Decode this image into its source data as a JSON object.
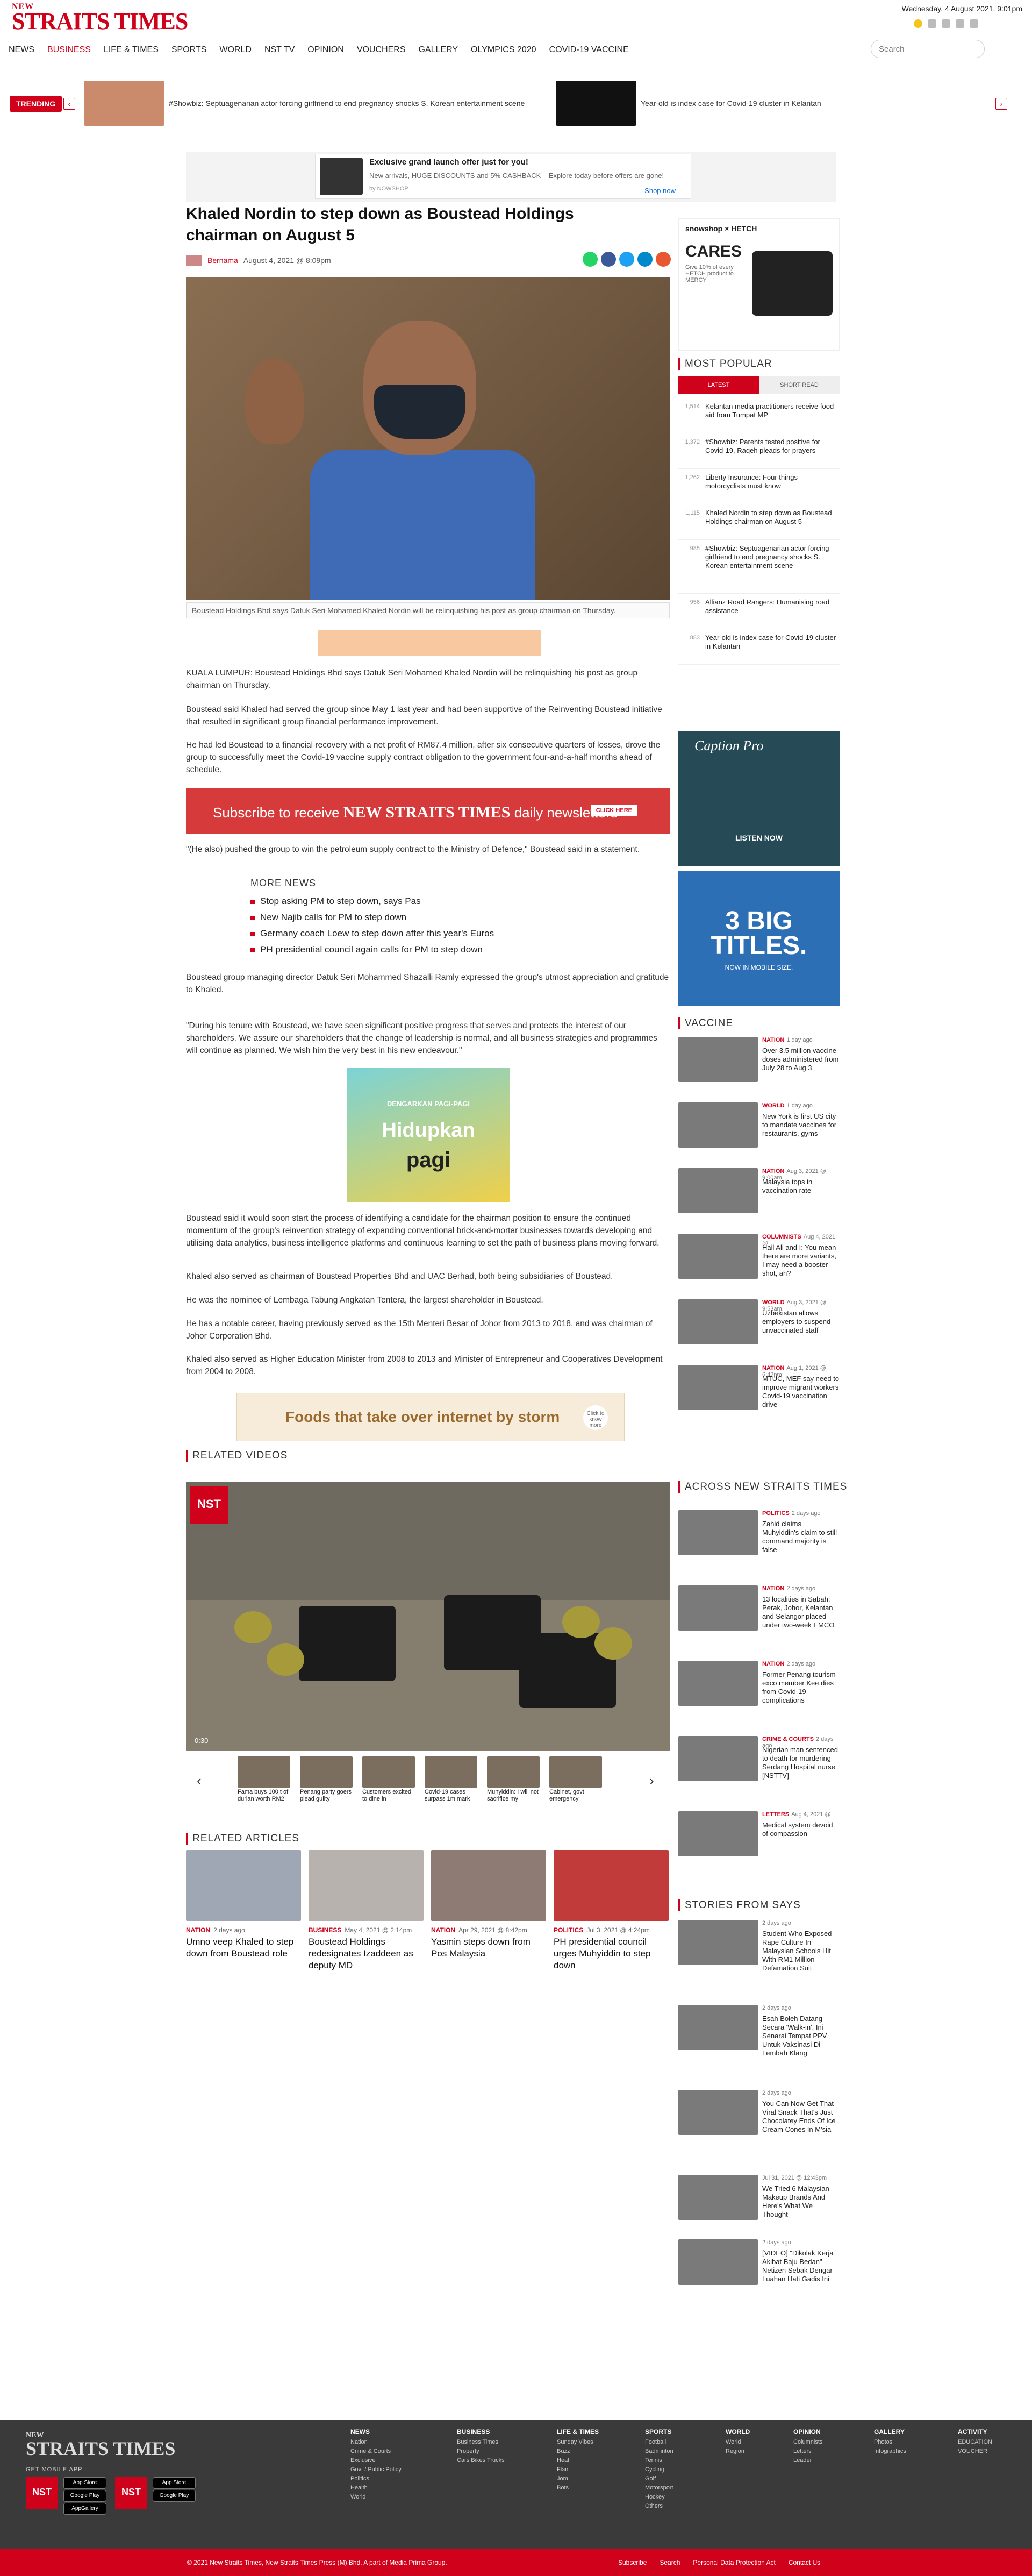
{
  "header": {
    "logo_new": "NEW",
    "logo_main": "STRAITS TIMES",
    "date": "Wednesday, 4 August 2021, 9:01pm"
  },
  "nav": [
    "NEWS",
    "BUSINESS",
    "LIFE & TIMES",
    "SPORTS",
    "WORLD",
    "NST TV",
    "OPINION",
    "VOUCHERS",
    "GALLERY",
    "OLYMPICS 2020",
    "COVID-19 VACCINE"
  ],
  "search": {
    "placeholder": "Search"
  },
  "trending": {
    "label": "TRENDING",
    "items": [
      "#Showbiz: Septuagenarian actor forcing girlfriend to end pregnancy shocks S. Korean entertainment scene",
      "Year-old is index case for Covid-19 cluster in Kelantan"
    ]
  },
  "ad_top": {
    "title": "Exclusive grand launch offer just for you!",
    "sub": "New arrivals, HUGE DISCOUNTS and 5% CASHBACK – Explore today before offers are gone!",
    "source": "by NOWSHOP",
    "cta": "Shop now"
  },
  "article": {
    "headline": "Khaled Nordin to step down as Boustead Holdings chairman on August 5",
    "author": "Bernama",
    "date": "August 4, 2021 @ 8:09pm",
    "caption": "Boustead Holdings Bhd says Datuk Seri Mohamed Khaled Nordin will be relinquishing his post as group chairman on Thursday.",
    "paragraphs": [
      "KUALA LUMPUR: Boustead Holdings Bhd says Datuk Seri Mohamed Khaled Nordin will be relinquishing his post as group chairman on Thursday.",
      "Boustead said Khaled had served the group since May 1 last year and had been supportive of the Reinventing Boustead initiative that resulted in significant group financial performance improvement.",
      "He had led Boustead to a financial recovery with a net profit of RM87.4 million, after six consecutive quarters of losses, drove the group to successfully meet the Covid-19 vaccine supply contract obligation to the government four-and-a-half months ahead of schedule.",
      "\"(He also) pushed the group to win the petroleum supply contract to the Ministry of Defence,\" Boustead said in a statement.",
      "Boustead group managing director Datuk Seri Mohammed Shazalli Ramly expressed the group's utmost appreciation and gratitude to Khaled.",
      "\"During his tenure with Boustead, we have seen significant positive progress that serves and protects the interest of our shareholders. We assure our shareholders that the change of leadership is normal, and all business strategies and programmes will continue as planned. We wish him the very best in his new endeavour.\"",
      "Boustead said it would soon start the process of identifying a candidate for the chairman position to ensure the continued momentum of the group's reinvention strategy of expanding conventional brick-and-mortar businesses towards developing and utilising data analytics, business intelligence platforms and continuous learning to set the path of business plans moving forward.",
      "Khaled also served as chairman of Boustead Properties Bhd and UAC Berhad, both being subsidiaries of Boustead.",
      "He was the nominee of Lembaga Tabung Angkatan Tentera, the largest shareholder in Boustead.",
      "He has a notable career, having previously served as the 15th Menteri Besar of Johor from 2013 to 2018, and was chairman of Johor Corporation Bhd.",
      "Khaled also served as Higher Education Minister from 2008 to 2013 and Minister of Entrepreneur and Cooperatives Development from 2004 to 2008."
    ]
  },
  "subscribe": {
    "text": "Subscribe to receive",
    "brand": "NEW STRAITS TIMES",
    "tail": "daily newsletters",
    "cta": "CLICK HERE"
  },
  "more_news": {
    "title": "MORE NEWS",
    "items": [
      "Stop asking PM to step down, says Pas",
      "New Najib calls for PM to step down",
      "Germany coach Loew to step down after this year's Euros",
      "PH presidential council again calls for PM to step down"
    ]
  },
  "ad_mid": {
    "l1": "DENGARKAN PAGI-PAGI",
    "l2": "Hidupkan",
    "l3": "pagi"
  },
  "ad_banner2": {
    "text": "Foods that take over internet by storm",
    "cta": "Click to know more"
  },
  "related_videos": {
    "title": "RELATED VIDEOS",
    "time": "0:30",
    "thumbs": [
      "Fama buys 100 t of durian worth RM2 mln",
      "Penang party goers plead guilty",
      "Customers excited to dine in",
      "Covid-19 cases surpass 1m mark",
      "Muhyiddin: I will not sacrifice my",
      "Cabinet, govt emergency"
    ]
  },
  "related_articles": {
    "title": "RELATED ARTICLES",
    "items": [
      {
        "tag": "NATION",
        "date": "2 days ago",
        "title": "Umno veep Khaled to step down from Boustead role"
      },
      {
        "tag": "BUSINESS",
        "date": "May 4, 2021 @ 2:14pm",
        "title": "Boustead Holdings redesignates Izaddeen as deputy MD"
      },
      {
        "tag": "NATION",
        "date": "Apr 29, 2021 @ 8:42pm",
        "title": "Yasmin steps down from Pos Malaysia"
      },
      {
        "tag": "POLITICS",
        "date": "Jul 3, 2021 @ 4:24pm",
        "title": "PH presidential council urges Muhyiddin to step down"
      }
    ]
  },
  "sidebar": {
    "ad1": {
      "brand": "snowshop × HETCH",
      "title": "CARES",
      "note": "Give 10% of every HETCH product to MERCY"
    },
    "popular": {
      "title": "MOST POPULAR",
      "tabs": [
        "LATEST",
        "SHORT READ"
      ],
      "items": [
        {
          "n": "1,514",
          "t": "Kelantan media practitioners receive food aid from Tumpat MP"
        },
        {
          "n": "1,372",
          "t": "#Showbiz: Parents tested positive for Covid-19, Raqeh pleads for prayers"
        },
        {
          "n": "1,262",
          "t": "Liberty Insurance: Four things motorcyclists must know"
        },
        {
          "n": "1,115",
          "t": "Khaled Nordin to step down as Boustead Holdings chairman on August 5"
        },
        {
          "n": "985",
          "t": "#Showbiz: Septuagenarian actor forcing girlfriend to end pregnancy shocks S. Korean entertainment scene"
        },
        {
          "n": "956",
          "t": "Allianz Road Rangers: Humanising road assistance"
        },
        {
          "n": "883",
          "t": "Year-old is index case for Covid-19 cluster in Kelantan"
        }
      ]
    },
    "ad2": {
      "title": "Caption Pro",
      "cta": "LISTEN NOW"
    },
    "ad3": {
      "title": "3 BIG TITLES.",
      "sub": "NOW IN MOBILE SIZE."
    },
    "vaccine": {
      "title": "VACCINE",
      "items": [
        {
          "tag": "NATION",
          "date": "1 day ago",
          "t": "Over 3.5 million vaccine doses administered from July 28 to Aug 3"
        },
        {
          "tag": "WORLD",
          "date": "1 day ago",
          "t": "New York is first US city to mandate vaccines for restaurants, gyms"
        },
        {
          "tag": "NATION",
          "date": "Aug 3, 2021 @ 9:00am",
          "t": "Malaysia tops in vaccination rate"
        },
        {
          "tag": "COLUMNISTS",
          "date": "Aug 4, 2021 @",
          "t": "Hail Ali and I: You mean there are more variants, I may need a booster shot, ah?"
        },
        {
          "tag": "WORLD",
          "date": "Aug 3, 2021 @ 9:53am",
          "t": "Uzbekistan allows employers to suspend unvaccinated staff"
        },
        {
          "tag": "NATION",
          "date": "Aug 1, 2021 @ 6:42pm",
          "t": "MTUC, MEF say need to improve migrant workers Covid-19 vaccination drive"
        }
      ]
    },
    "across": {
      "title": "ACROSS NEW STRAITS TIMES",
      "items": [
        {
          "tag": "POLITICS",
          "date": "2 days ago",
          "t": "Zahid claims Muhyiddin's claim to still command majority is false"
        },
        {
          "tag": "NATION",
          "date": "2 days ago",
          "t": "13 localities in Sabah, Perak, Johor, Kelantan and Selangor placed under two-week EMCO"
        },
        {
          "tag": "NATION",
          "date": "2 days ago",
          "t": "Former Penang tourism exco member Kee dies from Covid-19 complications"
        },
        {
          "tag": "CRIME & COURTS",
          "date": "2 days ago",
          "t": "Nigerian man sentenced to death for murdering Serdang Hospital nurse [NSTTV]"
        },
        {
          "tag": "LETTERS",
          "date": "Aug 4, 2021 @",
          "t": "Medical system devoid of compassion"
        }
      ]
    },
    "says": {
      "title": "STORIES FROM SAYS",
      "items": [
        {
          "date": "2 days ago",
          "t": "Student Who Exposed Rape Culture In Malaysian Schools Hit With RM1 Million Defamation Suit"
        },
        {
          "date": "2 days ago",
          "t": "Esah Boleh Datang Secara 'Walk-in', Ini Senarai Tempat PPV Untuk Vaksinasi Di Lembah Klang"
        },
        {
          "date": "2 days ago",
          "t": "You Can Now Get That Viral Snack That's Just Chocolatey Ends Of Ice Cream Cones In M'sia"
        },
        {
          "date": "Jul 31, 2021 @ 12:43pm",
          "t": "We Tried 6 Malaysian Makeup Brands And Here's What We Thought"
        },
        {
          "date": "2 days ago",
          "t": "[VIDEO] \"Dikolak Kerja Akibat Baju Bedan\" - Netizen Sebak Dengar Luahan Hati Gadis Ini"
        }
      ]
    }
  },
  "footer": {
    "logo_new": "NEW",
    "logo_main": "STRAITS TIMES",
    "get_mobile": "GET MOBILE APP",
    "apps": [
      "NST",
      "NST"
    ],
    "stores": [
      "App Store",
      "Google Play",
      "AppGallery",
      "App Store",
      "Google Play"
    ],
    "columns": [
      {
        "h": "NEWS",
        "items": [
          "Nation",
          "Crime & Courts",
          "Exclusive",
          "Govt / Public Policy",
          "Politics",
          "Health",
          "World"
        ]
      },
      {
        "h": "BUSINESS",
        "items": [
          "Business Times",
          "Property",
          "Cars Bikes Trucks"
        ]
      },
      {
        "h": "LIFE & TIMES",
        "items": [
          "Sunday Vibes",
          "Buzz",
          "Heal",
          "Flair",
          "Jom",
          "Bots"
        ]
      },
      {
        "h": "SPORTS",
        "items": [
          "Football",
          "Badminton",
          "Tennis",
          "Cycling",
          "Golf",
          "Motorsport",
          "Hockey",
          "Others"
        ]
      },
      {
        "h": "WORLD",
        "items": [
          "World",
          "Region"
        ]
      },
      {
        "h": "OPINION",
        "items": [
          "Columnists",
          "Letters",
          "Leader"
        ]
      },
      {
        "h": "GALLERY",
        "items": [
          "Photos",
          "Infographics"
        ]
      },
      {
        "h": "ACTIVITY",
        "items": [
          "EDUCATION",
          "VOUCHER"
        ]
      }
    ],
    "copyright": "© 2021 New Straits Times, New Straits Times Press (M) Bhd. A part of Media Prima Group.",
    "links": [
      "Subscribe",
      "Search",
      "Personal Data Protection Act",
      "Contact Us"
    ]
  },
  "colors": {
    "brand_red": "#d0021b"
  }
}
